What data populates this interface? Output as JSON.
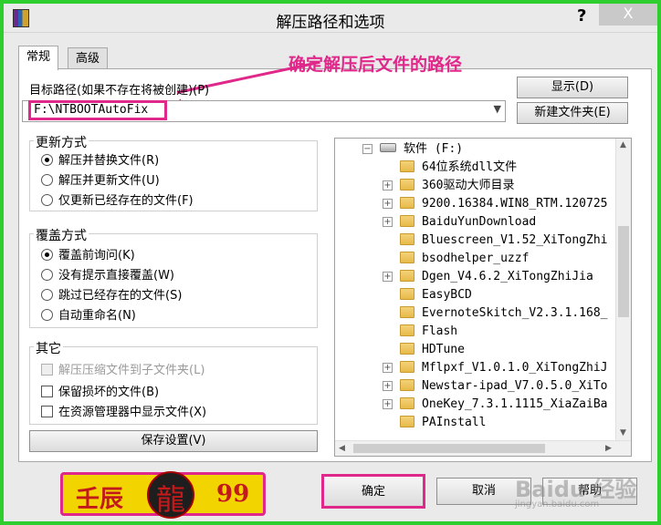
{
  "window": {
    "title": "解压路径和选项",
    "help_glyph": "?",
    "close_glyph": "X"
  },
  "tabs": [
    {
      "label": "常规",
      "active": true
    },
    {
      "label": "高级",
      "active": false
    }
  ],
  "annotation": "确定解压后文件的路径",
  "destination": {
    "label": "目标路径(如果不存在将被创建)(P)",
    "value": "F:\\NTBOOTAutoFix"
  },
  "side_buttons": {
    "display": "显示(D)",
    "new_folder": "新建文件夹(E)"
  },
  "update_mode": {
    "title": "更新方式",
    "options": [
      {
        "label": "解压并替换文件(R)",
        "selected": true
      },
      {
        "label": "解压并更新文件(U)",
        "selected": false
      },
      {
        "label": "仅更新已经存在的文件(F)",
        "selected": false
      }
    ]
  },
  "overwrite_mode": {
    "title": "覆盖方式",
    "options": [
      {
        "label": "覆盖前询问(K)",
        "selected": true
      },
      {
        "label": "没有提示直接覆盖(W)",
        "selected": false
      },
      {
        "label": "跳过已经存在的文件(S)",
        "selected": false
      },
      {
        "label": "自动重命名(N)",
        "selected": false
      }
    ]
  },
  "misc": {
    "title": "其它",
    "options": [
      {
        "label": "解压压缩文件到子文件夹(L)",
        "checked": false,
        "disabled": true
      },
      {
        "label": "保留损坏的文件(B)",
        "checked": false,
        "disabled": false
      },
      {
        "label": "在资源管理器中显示文件(X)",
        "checked": false,
        "disabled": false
      }
    ]
  },
  "save_settings": "保存设置(V)",
  "tree": {
    "drive": "软件 (F:)",
    "folders": [
      {
        "name": "64位系统dll文件",
        "expandable": false
      },
      {
        "name": "360驱动大师目录",
        "expandable": true
      },
      {
        "name": "9200.16384.WIN8_RTM.120725",
        "expandable": true
      },
      {
        "name": "BaiduYunDownload",
        "expandable": true
      },
      {
        "name": "Bluescreen_V1.52_XiTongZhi",
        "expandable": false
      },
      {
        "name": "bsodhelper_uzzf",
        "expandable": false
      },
      {
        "name": "Dgen_V4.6.2_XiTongZhiJia",
        "expandable": true
      },
      {
        "name": "EasyBCD",
        "expandable": false
      },
      {
        "name": "EvernoteSkitch_V2.3.1.168_",
        "expandable": false
      },
      {
        "name": "Flash",
        "expandable": false
      },
      {
        "name": "HDTune",
        "expandable": false
      },
      {
        "name": "Mflpxf_V1.0.1.0_XiTongZhiJ",
        "expandable": true
      },
      {
        "name": "Newstar-ipad_V7.0.5.0_XiTo",
        "expandable": true
      },
      {
        "name": "OneKey_7.3.1.1115_XiaZaiBa",
        "expandable": true
      },
      {
        "name": "PAInstall",
        "expandable": false
      }
    ]
  },
  "footer": {
    "ok": "确定",
    "cancel": "取消",
    "help": "帮助"
  },
  "logo": {
    "left": "壬辰",
    "right": "99"
  },
  "watermark": {
    "main": "Baidu 经验",
    "sub": "jingyan.baidu.com"
  },
  "colors": {
    "frame": "#2fce2f",
    "accent": "#e0278a"
  }
}
